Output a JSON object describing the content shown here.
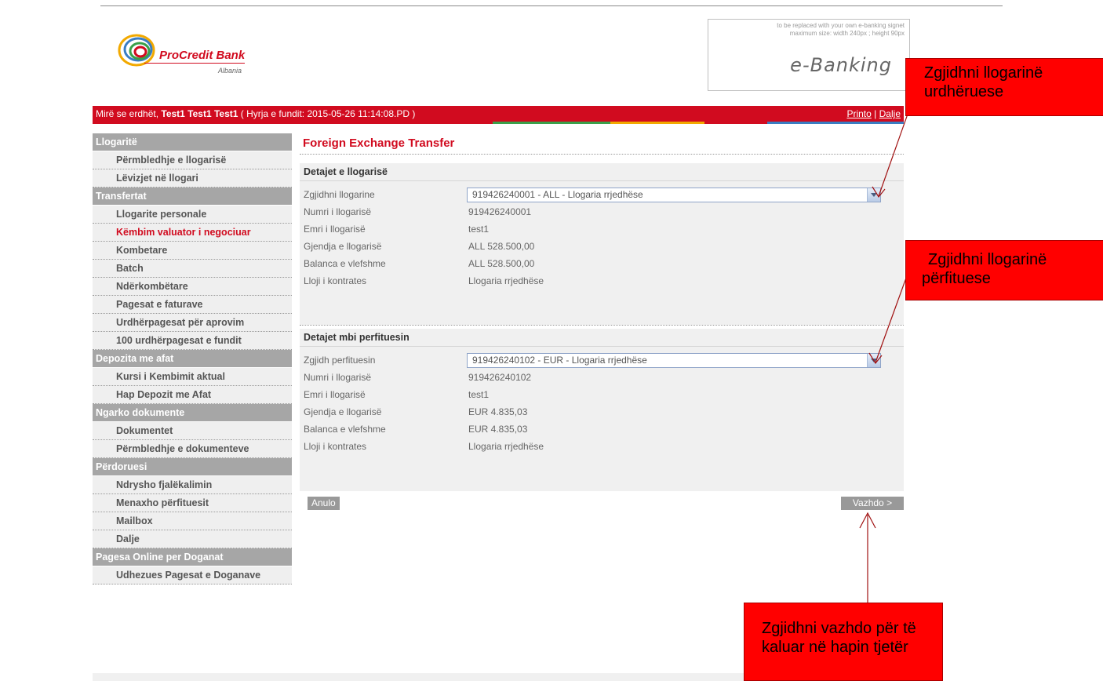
{
  "header": {
    "bank_name": "ProCredit Bank",
    "bank_country": "Albania",
    "signet_note_line1": "to be replaced with your own e-banking signet",
    "signet_note_line2": "maximum size:  width 240px ; height 90px",
    "ebanking_label": "e-Banking"
  },
  "welcome": {
    "prefix": "Mirë se erdhët, ",
    "user": "Test1 Test1 Test1",
    "last_login": " ( Hyrja e fundit: 2015-05-26 11:14:08.PD )",
    "print_link": "Printo",
    "separator": "|",
    "logout_link": "Dalje"
  },
  "sidebar": {
    "sections": [
      {
        "title": "Llogaritë",
        "items": [
          "Përmbledhje e llogarisë",
          "Lëvizjet në llogari"
        ]
      },
      {
        "title": "Transfertat",
        "items": [
          "Llogarite personale",
          "Këmbim valuator i negociuar",
          "Kombetare",
          "Batch",
          "Ndërkombëtare",
          "Pagesat e faturave",
          "Urdhërpagesat për aprovim",
          "100 urdhërpagesat e fundit"
        ]
      },
      {
        "title": "Depozita me afat",
        "items": [
          "Kursi i Kembimit aktual",
          "Hap Depozit me Afat"
        ]
      },
      {
        "title": "Ngarko dokumente",
        "items": [
          "Dokumentet",
          "Përmbledhje e dokumenteve"
        ]
      },
      {
        "title": "Përdoruesi",
        "items": [
          "Ndrysho fjalëkalimin",
          "Menaxho përfituesit",
          "Mailbox",
          "Dalje"
        ]
      },
      {
        "title": "Pagesa Online per Doganat",
        "items": [
          "Udhezues Pagesat e Doganave"
        ]
      }
    ],
    "active_item": "Këmbim valuator i negociuar"
  },
  "main": {
    "page_title": "Foreign Exchange Transfer",
    "account_section": {
      "heading": "Detajet e llogarisë",
      "select_label": "Zgjidhni llogarine",
      "select_value": "919426240001 - ALL - Llogaria rrjedhëse",
      "rows": [
        {
          "label": "Numri i llogarisë",
          "value": "919426240001"
        },
        {
          "label": "Emri i llogarisë",
          "value": "test1"
        },
        {
          "label": "Gjendja e llogarisë",
          "value": "ALL 528.500,00"
        },
        {
          "label": "Balanca e vlefshme",
          "value": "ALL 528.500,00"
        },
        {
          "label": "Lloji i kontrates",
          "value": "Llogaria rrjedhëse"
        }
      ]
    },
    "beneficiary_section": {
      "heading": "Detajet mbi perfituesin",
      "select_label": "Zgjidh perfituesin",
      "select_value": "919426240102 - EUR - Llogaria rrjedhëse",
      "rows": [
        {
          "label": "Numri i llogarisë",
          "value": "919426240102"
        },
        {
          "label": "Emri i llogarisë",
          "value": "test1"
        },
        {
          "label": "Gjendja e llogarisë",
          "value": "EUR 4.835,03"
        },
        {
          "label": "Balanca e vlefshme",
          "value": "EUR 4.835,03"
        },
        {
          "label": "Lloji i kontrates",
          "value": "Llogaria rrjedhëse"
        }
      ]
    },
    "cancel_button": "Anulo",
    "continue_button": "Vazhdo >"
  },
  "callouts": {
    "source_line1": "Zgjidhni llogarinë",
    "source_line2": "urdhëruese",
    "beneficiary_line1": "Zgjidhni llogarinë",
    "beneficiary_line2": "përfituese",
    "continue_line1": "Zgjidhni vazhdo për të",
    "continue_line2": "kaluar në hapin tjetër"
  },
  "colors": {
    "brand_red": "#d10b1f",
    "callout_red": "#ff0000",
    "sidebar_section": "#a6a6a6"
  }
}
